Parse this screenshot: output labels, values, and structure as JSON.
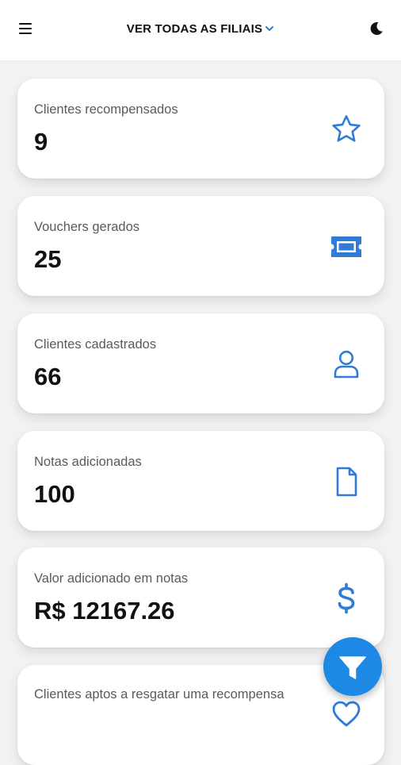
{
  "header": {
    "branch_selector": "VER TODAS AS FILIAIS"
  },
  "cards": [
    {
      "label": "Clientes recompensados",
      "value": "9",
      "icon": "star-icon"
    },
    {
      "label": "Vouchers gerados",
      "value": "25",
      "icon": "ticket-icon"
    },
    {
      "label": "Clientes cadastrados",
      "value": "66",
      "icon": "user-icon"
    },
    {
      "label": "Notas adicionadas",
      "value": "100",
      "icon": "document-icon"
    },
    {
      "label": "Valor adicionado em notas",
      "value": "R$ 12167.26",
      "icon": "dollar-icon"
    },
    {
      "label": "Clientes aptos a resgatar uma recompensa",
      "value": "",
      "icon": "heart-icon"
    }
  ],
  "colors": {
    "accent": "#1e88e5",
    "icon_blue": "#2f7bd5",
    "background": "#f2f2f2",
    "card": "#ffffff"
  }
}
